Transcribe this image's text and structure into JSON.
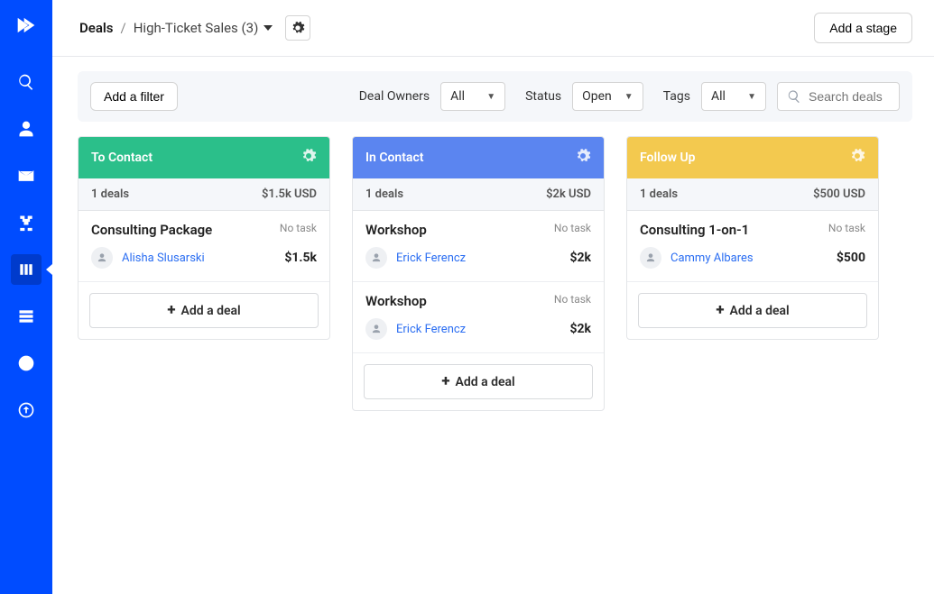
{
  "breadcrumb": {
    "root": "Deals",
    "current": "High-Ticket Sales (3)"
  },
  "topbar": {
    "add_stage": "Add a stage"
  },
  "filters": {
    "add_filter": "Add a filter",
    "owners_label": "Deal Owners",
    "owners_value": "All",
    "status_label": "Status",
    "status_value": "Open",
    "tags_label": "Tags",
    "tags_value": "All",
    "search_placeholder": "Search deals"
  },
  "columns": [
    {
      "title": "To Contact",
      "color": "col-green",
      "summary_count": "1 deals",
      "summary_total": "$1.5k USD",
      "deals": [
        {
          "title": "Consulting Package",
          "task": "No task",
          "person": "Alisha Slusarski",
          "amount": "$1.5k"
        }
      ]
    },
    {
      "title": "In Contact",
      "color": "col-blue",
      "summary_count": "1 deals",
      "summary_total": "$2k USD",
      "deals": [
        {
          "title": "Workshop",
          "task": "No task",
          "person": "Erick Ferencz",
          "amount": "$2k"
        },
        {
          "title": "Workshop",
          "task": "No task",
          "person": "Erick Ferencz",
          "amount": "$2k"
        }
      ]
    },
    {
      "title": "Follow Up",
      "color": "col-yellow",
      "summary_count": "1 deals",
      "summary_total": "$500 USD",
      "deals": [
        {
          "title": "Consulting 1-on-1",
          "task": "No task",
          "person": "Cammy Albares",
          "amount": "$500"
        }
      ]
    }
  ],
  "labels": {
    "add_deal": "Add a deal"
  }
}
